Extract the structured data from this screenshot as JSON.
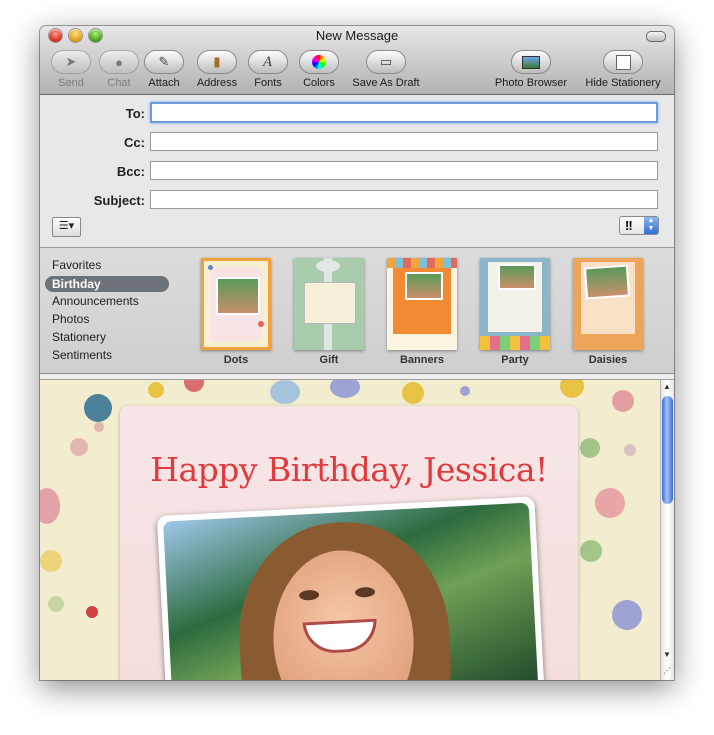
{
  "window": {
    "title": "New Message"
  },
  "toolbar": {
    "send": "Send",
    "chat": "Chat",
    "attach": "Attach",
    "address": "Address",
    "fonts": "Fonts",
    "colors": "Colors",
    "save_draft": "Save As Draft",
    "photo_browser": "Photo Browser",
    "hide_stationery": "Hide Stationery"
  },
  "headers": {
    "to_label": "To:",
    "cc_label": "Cc:",
    "bcc_label": "Bcc:",
    "subject_label": "Subject:",
    "to_value": "",
    "cc_value": "",
    "bcc_value": "",
    "subject_value": "",
    "priority_symbol": "!!"
  },
  "stationery": {
    "categories": [
      "Favorites",
      "Birthday",
      "Announcements",
      "Photos",
      "Stationery",
      "Sentiments"
    ],
    "selected_category": "Birthday",
    "templates": [
      "Dots",
      "Gift",
      "Banners",
      "Party",
      "Daisies"
    ]
  },
  "message": {
    "greeting": "Happy Birthday, Jessica!"
  },
  "colors": {
    "greeting_red": "#e03a3e",
    "selection_gray": "#6e727b",
    "scroll_blue": "#3b6fd1"
  }
}
